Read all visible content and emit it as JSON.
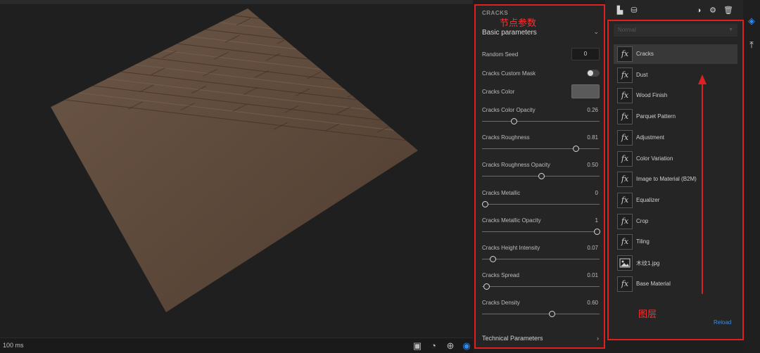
{
  "viewport": {
    "zoom_label": "100 ms",
    "tools": [
      {
        "name": "camera-icon",
        "glyph": "▣",
        "color": "#bdbdbd"
      },
      {
        "name": "environment-icon",
        "glyph": "◔",
        "color": "#bdbdbd"
      },
      {
        "name": "globe-icon",
        "glyph": "⊕",
        "color": "#bdbdbd"
      },
      {
        "name": "render-mode-icon",
        "glyph": "◉",
        "color": "#2f8bf0"
      }
    ]
  },
  "params_panel": {
    "title": "CRACKS",
    "section_label": "Basic parameters",
    "random_seed": {
      "label": "Random Seed",
      "value": "0"
    },
    "custom_mask": {
      "label": "Cracks Custom Mask",
      "on": false
    },
    "color": {
      "label": "Cracks Color",
      "swatch": "#5a5a5a"
    },
    "sliders": [
      {
        "label": "Cracks Color Opacity",
        "value": "0.26",
        "fraction": 0.26
      },
      {
        "label": "Cracks Roughness",
        "value": "0.81",
        "fraction": 0.81
      },
      {
        "label": "Cracks Roughness Opacity",
        "value": "0.50",
        "fraction": 0.5
      },
      {
        "label": "Cracks Metallic",
        "value": "0",
        "fraction": 0
      },
      {
        "label": "Cracks Metallic Opacity",
        "value": "1",
        "fraction": 1
      },
      {
        "label": "Cracks Height Intensity",
        "value": "0.07",
        "fraction": 0.07
      },
      {
        "label": "Cracks Spread",
        "value": "0.01",
        "fraction": 0.01
      },
      {
        "label": "Cracks Density",
        "value": "0.60",
        "fraction": 0.6
      }
    ],
    "technical_label": "Technical Parameters"
  },
  "layers_panel": {
    "blend_mode": "Normal",
    "items": [
      {
        "name": "Cracks",
        "icon": "fx",
        "selected": true
      },
      {
        "name": "Dust",
        "icon": "fx"
      },
      {
        "name": "Wood Finish",
        "icon": "fx"
      },
      {
        "name": "Parquet Pattern",
        "icon": "fx"
      },
      {
        "name": "Adjustment",
        "icon": "fx"
      },
      {
        "name": "Color Variation",
        "icon": "fx"
      },
      {
        "name": "Image to Material (B2M)",
        "icon": "fx"
      },
      {
        "name": "Equalizer",
        "icon": "fx"
      },
      {
        "name": "Crop",
        "icon": "fx"
      },
      {
        "name": "Tiling",
        "icon": "fx"
      },
      {
        "name": "木纹1.jpg",
        "icon": "image"
      },
      {
        "name": "Base Material",
        "icon": "fx"
      }
    ],
    "reload_label": "Reload"
  },
  "toolbar": {
    "left_icons": [
      "save-icon",
      "stack-settings-icon"
    ],
    "right_icons": [
      "contrast-icon",
      "gear-icon",
      "trash-icon"
    ]
  },
  "rail": {
    "icons": [
      "layers-icon",
      "export-icon"
    ],
    "accent": "#2f8bf0"
  },
  "annotations": {
    "params_label": "节点参数",
    "layers_label": "图层",
    "color": "#e02020"
  }
}
